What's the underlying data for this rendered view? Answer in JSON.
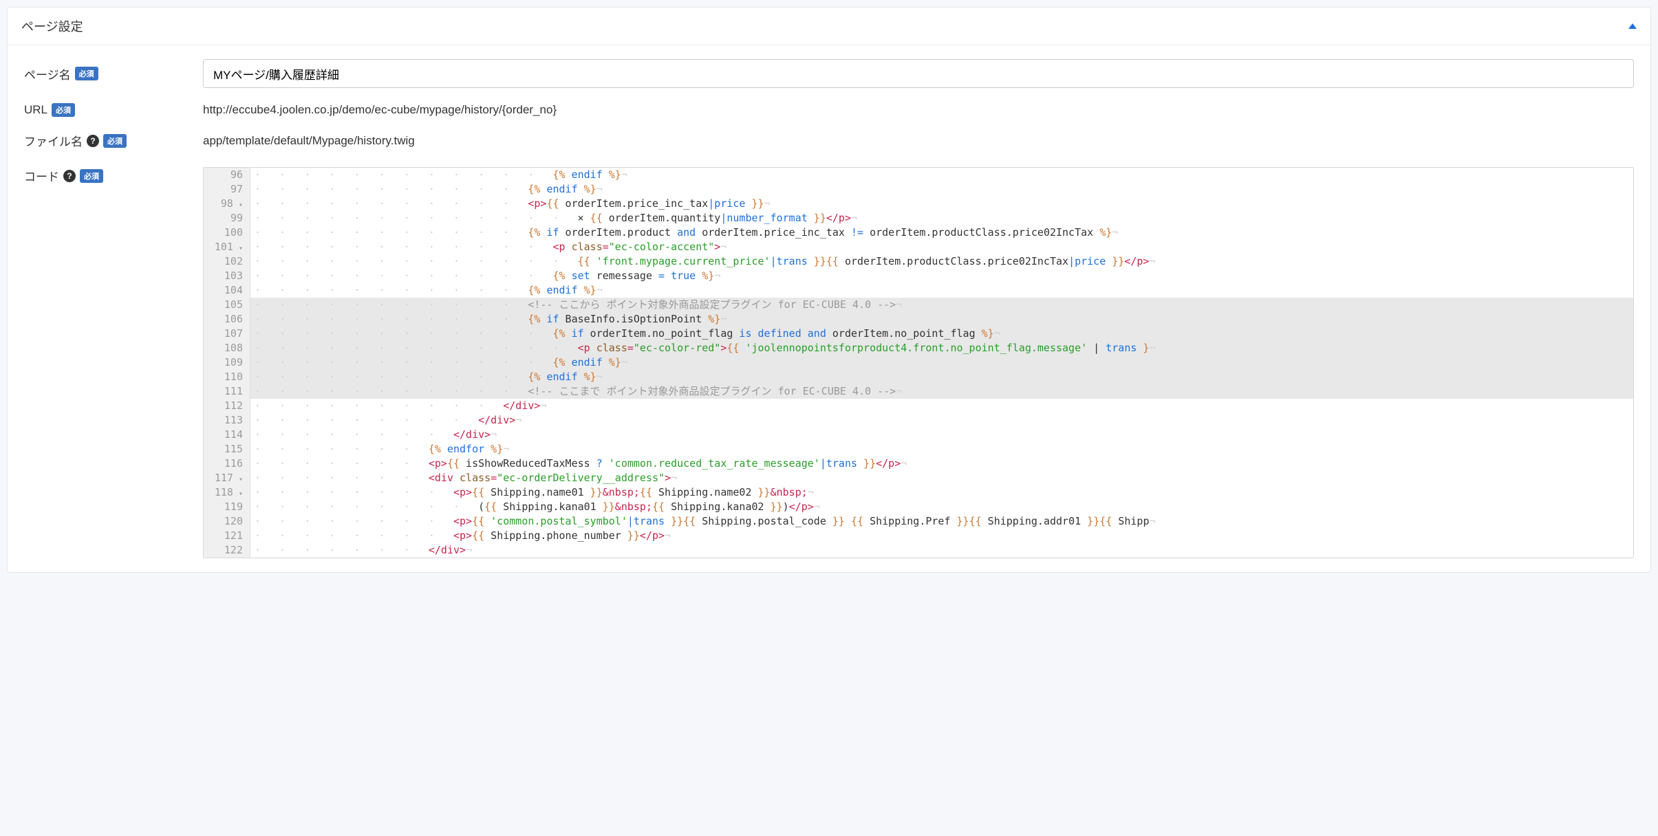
{
  "header": {
    "title": "ページ設定"
  },
  "labels": {
    "pageName": "ページ名",
    "url": "URL",
    "fileName": "ファイル名",
    "code": "コード",
    "required": "必須"
  },
  "fields": {
    "pageNameValue": "MYページ/購入履歴詳細",
    "urlValue": "http://eccube4.joolen.co.jp/demo/ec-cube/mypage/history/{order_no}",
    "fileNameValue": "app/template/default/Mypage/history.twig"
  },
  "editor": {
    "startLine": 96,
    "highlightStart": 105,
    "highlightEnd": 111,
    "foldLines": [
      98,
      101,
      117,
      118
    ],
    "lines": [
      {
        "n": 96,
        "indent": 12,
        "segs": [
          {
            "c": "t-orange",
            "t": "{% "
          },
          {
            "c": "t-blue",
            "t": "endif"
          },
          {
            "c": "t-orange",
            "t": " %}"
          }
        ]
      },
      {
        "n": 97,
        "indent": 11,
        "segs": [
          {
            "c": "t-orange",
            "t": "{% "
          },
          {
            "c": "t-blue",
            "t": "endif"
          },
          {
            "c": "t-orange",
            "t": " %}"
          }
        ]
      },
      {
        "n": 98,
        "indent": 11,
        "segs": [
          {
            "c": "t-red",
            "t": "<p>"
          },
          {
            "c": "t-orange",
            "t": "{{"
          },
          {
            "c": "t-dark",
            "t": " orderItem.price_inc_tax"
          },
          {
            "c": "t-blue",
            "t": "|"
          },
          {
            "c": "t-blue",
            "t": "price"
          },
          {
            "c": "t-orange",
            "t": " }}"
          }
        ]
      },
      {
        "n": 99,
        "indent": 13,
        "segs": [
          {
            "c": "t-dark",
            "t": "× "
          },
          {
            "c": "t-orange",
            "t": "{{"
          },
          {
            "c": "t-dark",
            "t": " orderItem.quantity"
          },
          {
            "c": "t-blue",
            "t": "|"
          },
          {
            "c": "t-blue",
            "t": "number_format"
          },
          {
            "c": "t-orange",
            "t": " }}"
          },
          {
            "c": "t-red",
            "t": "</p>"
          }
        ]
      },
      {
        "n": 100,
        "indent": 11,
        "segs": [
          {
            "c": "t-orange",
            "t": "{% "
          },
          {
            "c": "t-blue",
            "t": "if"
          },
          {
            "c": "t-dark",
            "t": " orderItem.product "
          },
          {
            "c": "t-blue",
            "t": "and"
          },
          {
            "c": "t-dark",
            "t": " orderItem.price_inc_tax "
          },
          {
            "c": "t-blue",
            "t": "!="
          },
          {
            "c": "t-dark",
            "t": " orderItem.productClass.price02IncTax "
          },
          {
            "c": "t-orange",
            "t": "%}"
          }
        ]
      },
      {
        "n": 101,
        "indent": 12,
        "segs": [
          {
            "c": "t-red",
            "t": "<p "
          },
          {
            "c": "t-attr",
            "t": "class"
          },
          {
            "c": "t-red",
            "t": "="
          },
          {
            "c": "t-string",
            "t": "\"ec-color-accent\""
          },
          {
            "c": "t-red",
            "t": ">"
          }
        ]
      },
      {
        "n": 102,
        "indent": 13,
        "segs": [
          {
            "c": "t-orange",
            "t": "{{ "
          },
          {
            "c": "t-string",
            "t": "'front.mypage.current_price'"
          },
          {
            "c": "t-blue",
            "t": "|"
          },
          {
            "c": "t-blue",
            "t": "trans"
          },
          {
            "c": "t-orange",
            "t": " }}"
          },
          {
            "c": "t-orange",
            "t": "{{"
          },
          {
            "c": "t-dark",
            "t": " orderItem.productClass.price02IncTax"
          },
          {
            "c": "t-blue",
            "t": "|"
          },
          {
            "c": "t-blue",
            "t": "price"
          },
          {
            "c": "t-orange",
            "t": " }}"
          },
          {
            "c": "t-red",
            "t": "</p>"
          }
        ]
      },
      {
        "n": 103,
        "indent": 12,
        "segs": [
          {
            "c": "t-orange",
            "t": "{% "
          },
          {
            "c": "t-blue",
            "t": "set"
          },
          {
            "c": "t-dark",
            "t": " remessage "
          },
          {
            "c": "t-blue",
            "t": "="
          },
          {
            "c": "t-dark",
            "t": " "
          },
          {
            "c": "t-blue",
            "t": "true"
          },
          {
            "c": "t-orange",
            "t": " %}"
          }
        ]
      },
      {
        "n": 104,
        "indent": 11,
        "segs": [
          {
            "c": "t-orange",
            "t": "{% "
          },
          {
            "c": "t-blue",
            "t": "endif"
          },
          {
            "c": "t-orange",
            "t": " %}"
          }
        ]
      },
      {
        "n": 105,
        "indent": 11,
        "segs": [
          {
            "c": "t-grey",
            "t": "<!-- ここから ポイント対象外商品設定プラグイン for EC-CUBE 4.0 -->"
          }
        ]
      },
      {
        "n": 106,
        "indent": 11,
        "segs": [
          {
            "c": "t-orange",
            "t": "{% "
          },
          {
            "c": "t-blue",
            "t": "if"
          },
          {
            "c": "t-dark",
            "t": " BaseInfo.isOptionPoint "
          },
          {
            "c": "t-orange",
            "t": "%}"
          }
        ]
      },
      {
        "n": 107,
        "indent": 12,
        "segs": [
          {
            "c": "t-orange",
            "t": "{% "
          },
          {
            "c": "t-blue",
            "t": "if"
          },
          {
            "c": "t-dark",
            "t": " orderItem.no_point_flag "
          },
          {
            "c": "t-blue",
            "t": "is"
          },
          {
            "c": "t-dark",
            "t": " "
          },
          {
            "c": "t-blue",
            "t": "defined"
          },
          {
            "c": "t-dark",
            "t": " "
          },
          {
            "c": "t-blue",
            "t": "and"
          },
          {
            "c": "t-dark",
            "t": " orderItem.no_point_flag "
          },
          {
            "c": "t-orange",
            "t": "%}"
          }
        ]
      },
      {
        "n": 108,
        "indent": 13,
        "segs": [
          {
            "c": "t-red",
            "t": "<p "
          },
          {
            "c": "t-attr",
            "t": "class"
          },
          {
            "c": "t-red",
            "t": "="
          },
          {
            "c": "t-string",
            "t": "\"ec-color-red\""
          },
          {
            "c": "t-red",
            "t": ">"
          },
          {
            "c": "t-orange",
            "t": "{{ "
          },
          {
            "c": "t-string",
            "t": "'joolennopointsforproduct4.front.no_point_flag.message'"
          },
          {
            "c": "t-dark",
            "t": " | "
          },
          {
            "c": "t-blue",
            "t": "trans"
          },
          {
            "c": "t-orange",
            "t": " }"
          }
        ]
      },
      {
        "n": 109,
        "indent": 12,
        "segs": [
          {
            "c": "t-orange",
            "t": "{% "
          },
          {
            "c": "t-blue",
            "t": "endif"
          },
          {
            "c": "t-orange",
            "t": " %}"
          }
        ]
      },
      {
        "n": 110,
        "indent": 11,
        "segs": [
          {
            "c": "t-orange",
            "t": "{% "
          },
          {
            "c": "t-blue",
            "t": "endif"
          },
          {
            "c": "t-orange",
            "t": " %}"
          }
        ]
      },
      {
        "n": 111,
        "indent": 11,
        "segs": [
          {
            "c": "t-grey",
            "t": "<!-- ここまで ポイント対象外商品設定プラグイン for EC-CUBE 4.0 -->"
          }
        ]
      },
      {
        "n": 112,
        "indent": 10,
        "segs": [
          {
            "c": "t-red",
            "t": "</div>"
          }
        ]
      },
      {
        "n": 113,
        "indent": 9,
        "segs": [
          {
            "c": "t-red",
            "t": "</div>"
          }
        ]
      },
      {
        "n": 114,
        "indent": 8,
        "segs": [
          {
            "c": "t-red",
            "t": "</div>"
          }
        ]
      },
      {
        "n": 115,
        "indent": 7,
        "segs": [
          {
            "c": "t-orange",
            "t": "{% "
          },
          {
            "c": "t-blue",
            "t": "endfor"
          },
          {
            "c": "t-orange",
            "t": " %}"
          }
        ]
      },
      {
        "n": 116,
        "indent": 7,
        "segs": [
          {
            "c": "t-red",
            "t": "<p>"
          },
          {
            "c": "t-orange",
            "t": "{{"
          },
          {
            "c": "t-dark",
            "t": " isShowReducedTaxMess "
          },
          {
            "c": "t-blue",
            "t": "?"
          },
          {
            "c": "t-dark",
            "t": " "
          },
          {
            "c": "t-string",
            "t": "'common.reduced_tax_rate_messeage'"
          },
          {
            "c": "t-blue",
            "t": "|"
          },
          {
            "c": "t-blue",
            "t": "trans"
          },
          {
            "c": "t-orange",
            "t": " }}"
          },
          {
            "c": "t-red",
            "t": "</p>"
          }
        ]
      },
      {
        "n": 117,
        "indent": 7,
        "segs": [
          {
            "c": "t-red",
            "t": "<div "
          },
          {
            "c": "t-attr",
            "t": "class"
          },
          {
            "c": "t-red",
            "t": "="
          },
          {
            "c": "t-string",
            "t": "\"ec-orderDelivery__address\""
          },
          {
            "c": "t-red",
            "t": ">"
          }
        ]
      },
      {
        "n": 118,
        "indent": 8,
        "segs": [
          {
            "c": "t-red",
            "t": "<p>"
          },
          {
            "c": "t-orange",
            "t": "{{"
          },
          {
            "c": "t-dark",
            "t": " Shipping.name01 "
          },
          {
            "c": "t-orange",
            "t": "}}"
          },
          {
            "c": "t-red",
            "t": "&nbsp;"
          },
          {
            "c": "t-orange",
            "t": "{{"
          },
          {
            "c": "t-dark",
            "t": " Shipping.name02 "
          },
          {
            "c": "t-orange",
            "t": "}}"
          },
          {
            "c": "t-red",
            "t": "&nbsp;"
          }
        ]
      },
      {
        "n": 119,
        "indent": 9,
        "segs": [
          {
            "c": "t-dark",
            "t": "("
          },
          {
            "c": "t-orange",
            "t": "{{"
          },
          {
            "c": "t-dark",
            "t": " Shipping.kana01 "
          },
          {
            "c": "t-orange",
            "t": "}}"
          },
          {
            "c": "t-red",
            "t": "&nbsp;"
          },
          {
            "c": "t-orange",
            "t": "{{"
          },
          {
            "c": "t-dark",
            "t": " Shipping.kana02 "
          },
          {
            "c": "t-orange",
            "t": "}}"
          },
          {
            "c": "t-dark",
            "t": ")"
          },
          {
            "c": "t-red",
            "t": "</p>"
          }
        ]
      },
      {
        "n": 120,
        "indent": 8,
        "segs": [
          {
            "c": "t-red",
            "t": "<p>"
          },
          {
            "c": "t-orange",
            "t": "{{ "
          },
          {
            "c": "t-string",
            "t": "'common.postal_symbol'"
          },
          {
            "c": "t-blue",
            "t": "|"
          },
          {
            "c": "t-blue",
            "t": "trans"
          },
          {
            "c": "t-orange",
            "t": " }}"
          },
          {
            "c": "t-orange",
            "t": "{{"
          },
          {
            "c": "t-dark",
            "t": " Shipping.postal_code "
          },
          {
            "c": "t-orange",
            "t": "}}"
          },
          {
            "c": "t-dark",
            "t": " "
          },
          {
            "c": "t-orange",
            "t": "{{"
          },
          {
            "c": "t-dark",
            "t": " Shipping.Pref "
          },
          {
            "c": "t-orange",
            "t": "}}"
          },
          {
            "c": "t-orange",
            "t": "{{"
          },
          {
            "c": "t-dark",
            "t": " Shipping.addr01 "
          },
          {
            "c": "t-orange",
            "t": "}}"
          },
          {
            "c": "t-orange",
            "t": "{{"
          },
          {
            "c": "t-dark",
            "t": " Shipp"
          }
        ]
      },
      {
        "n": 121,
        "indent": 8,
        "segs": [
          {
            "c": "t-red",
            "t": "<p>"
          },
          {
            "c": "t-orange",
            "t": "{{"
          },
          {
            "c": "t-dark",
            "t": " Shipping.phone_number "
          },
          {
            "c": "t-orange",
            "t": "}}"
          },
          {
            "c": "t-red",
            "t": "</p>"
          }
        ]
      },
      {
        "n": 122,
        "indent": 7,
        "segs": [
          {
            "c": "t-red",
            "t": "</div>"
          }
        ]
      }
    ]
  }
}
